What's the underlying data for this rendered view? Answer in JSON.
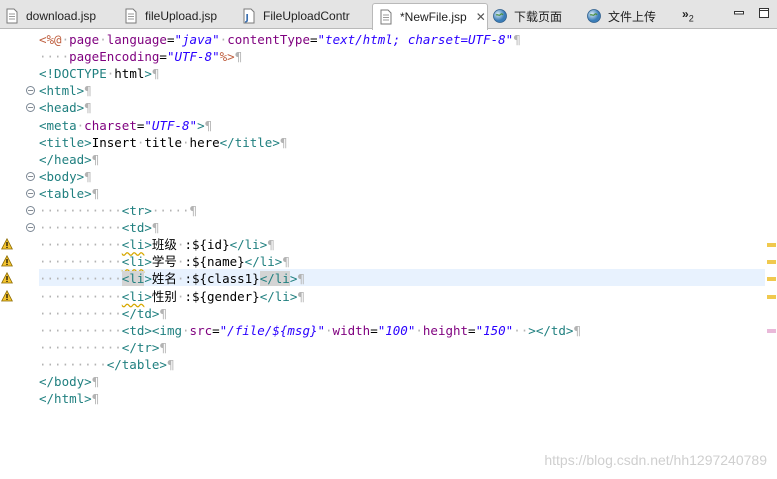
{
  "tabs": [
    {
      "label": "download.jsp",
      "icon": "jsp-file-icon",
      "active": false
    },
    {
      "label": "fileUpload.jsp",
      "icon": "jsp-file-icon",
      "active": false
    },
    {
      "label": "FileUploadContr",
      "icon": "java-file-icon",
      "active": false
    },
    {
      "label": "*NewFile.jsp",
      "icon": "jsp-file-icon",
      "active": true
    },
    {
      "label": "下载页面",
      "icon": "globe-icon",
      "active": false
    },
    {
      "label": "文件上传",
      "icon": "globe-icon",
      "active": false
    }
  ],
  "overflow": {
    "symbol": "»",
    "count": "2"
  },
  "watermark": "https://blog.csdn.net/hh1297240789",
  "colors": {
    "tag": "#1f7f7f",
    "attribute": "#7f007f",
    "value": "#2a00ff",
    "directive": "#bf5f3f",
    "whitespace": "#b3b3b3",
    "current_line": "#e8f2fe"
  },
  "code_lines": [
    "<%@ page language=\"java\" contentType=\"text/html; charset=UTF-8\"",
    "    pageEncoding=\"UTF-8\"%>",
    "<!DOCTYPE html>",
    "<html>",
    "<head>",
    "<meta charset=\"UTF-8\">",
    "<title>Insert title here</title>",
    "</head>",
    "<body>",
    "<table>",
    "           <tr>     ",
    "           <td>",
    "           <li>班级 :${id}</li>",
    "           <li>学号 :${name}</li>",
    "           <li>姓名 :${class1}</li>",
    "           <li>性别 :${gender}</li>",
    "           </td>",
    "           <td><img src=\"/file/${msg}\" width=\"100\" height=\"150\"  ></td>",
    "           </tr>",
    "         </table>",
    "</body>",
    "</html>"
  ],
  "warning_lines": [
    13,
    14,
    15,
    16
  ],
  "current_line": 15,
  "folded_lines": [
    4,
    5,
    9,
    10,
    11,
    12
  ]
}
